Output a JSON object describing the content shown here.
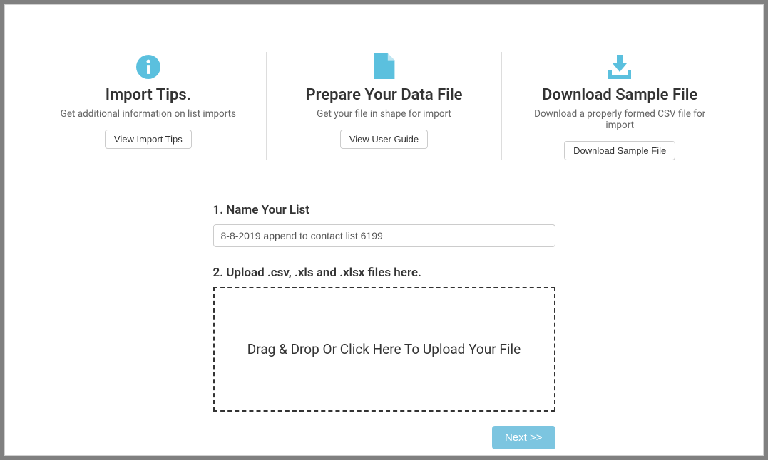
{
  "colors": {
    "accent": "#5bc0de",
    "nextBtn": "#7cc5e0"
  },
  "top": {
    "tips": {
      "title": "Import Tips.",
      "subtitle": "Get additional information on list imports",
      "button": "View Import Tips"
    },
    "prepare": {
      "title": "Prepare Your Data File",
      "subtitle": "Get your file in shape for import",
      "button": "View User Guide"
    },
    "download": {
      "title": "Download Sample File",
      "subtitle": "Download a properly formed CSV file for import",
      "button": "Download Sample File"
    }
  },
  "form": {
    "step1Label": "1. Name Your List",
    "listNameValue": "8-8-2019 append to contact list 6199",
    "step2Label": "2. Upload .csv, .xls and .xlsx files here.",
    "dropzoneText": "Drag & Drop Or Click Here To Upload Your File",
    "nextButton": "Next >>"
  }
}
